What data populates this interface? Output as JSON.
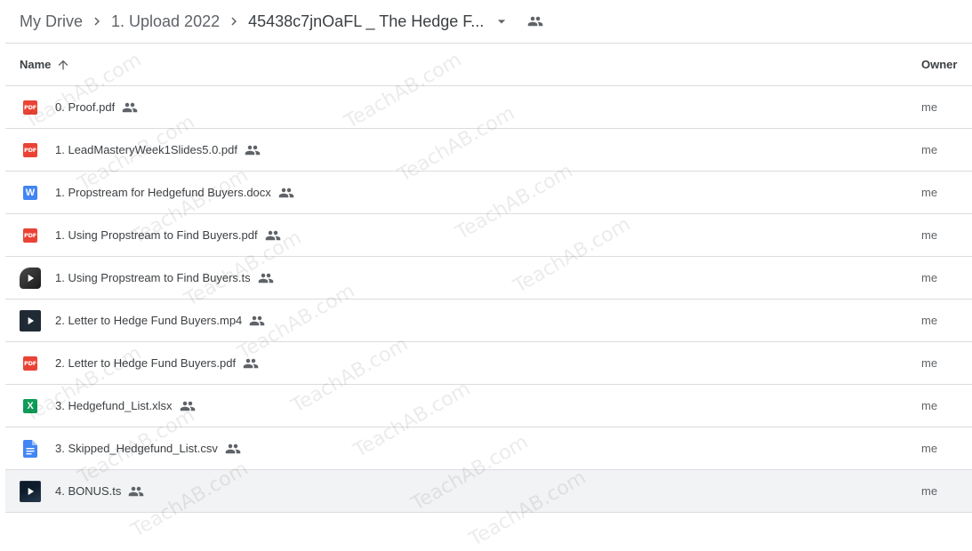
{
  "breadcrumb": {
    "items": [
      "My Drive",
      "1. Upload 2022",
      "45438c7jnOaFL _ The Hedge F..."
    ]
  },
  "table": {
    "columns": {
      "name": "Name",
      "owner": "Owner"
    },
    "rows": [
      {
        "name": "0. Proof.pdf",
        "type": "pdf",
        "owner": "me"
      },
      {
        "name": "1. LeadMasteryWeek1Slides5.0.pdf",
        "type": "pdf",
        "owner": "me"
      },
      {
        "name": "1. Propstream for Hedgefund Buyers.docx",
        "type": "word",
        "owner": "me"
      },
      {
        "name": "1. Using Propstream to Find Buyers.pdf",
        "type": "pdf",
        "owner": "me"
      },
      {
        "name": "1. Using Propstream to Find Buyers.ts",
        "type": "video",
        "owner": "me"
      },
      {
        "name": "2. Letter to Hedge Fund Buyers.mp4",
        "type": "video",
        "owner": "me"
      },
      {
        "name": "2. Letter to Hedge Fund Buyers.pdf",
        "type": "pdf",
        "owner": "me"
      },
      {
        "name": "3. Hedgefund_List.xlsx",
        "type": "excel",
        "owner": "me"
      },
      {
        "name": "3. Skipped_Hedgefund_List.csv",
        "type": "doc",
        "owner": "me"
      },
      {
        "name": "4. BONUS.ts",
        "type": "video",
        "owner": "me"
      }
    ]
  },
  "icons": {
    "pdf_label": "PDF",
    "word_label": "W",
    "excel_label": "X"
  },
  "watermark": "TeachAB.com",
  "colors": {
    "pdf": "#ea4335",
    "word": "#4285f4",
    "excel": "#0f9d58",
    "doc": "#4285f4",
    "selected_row": "#f1f3f4"
  }
}
